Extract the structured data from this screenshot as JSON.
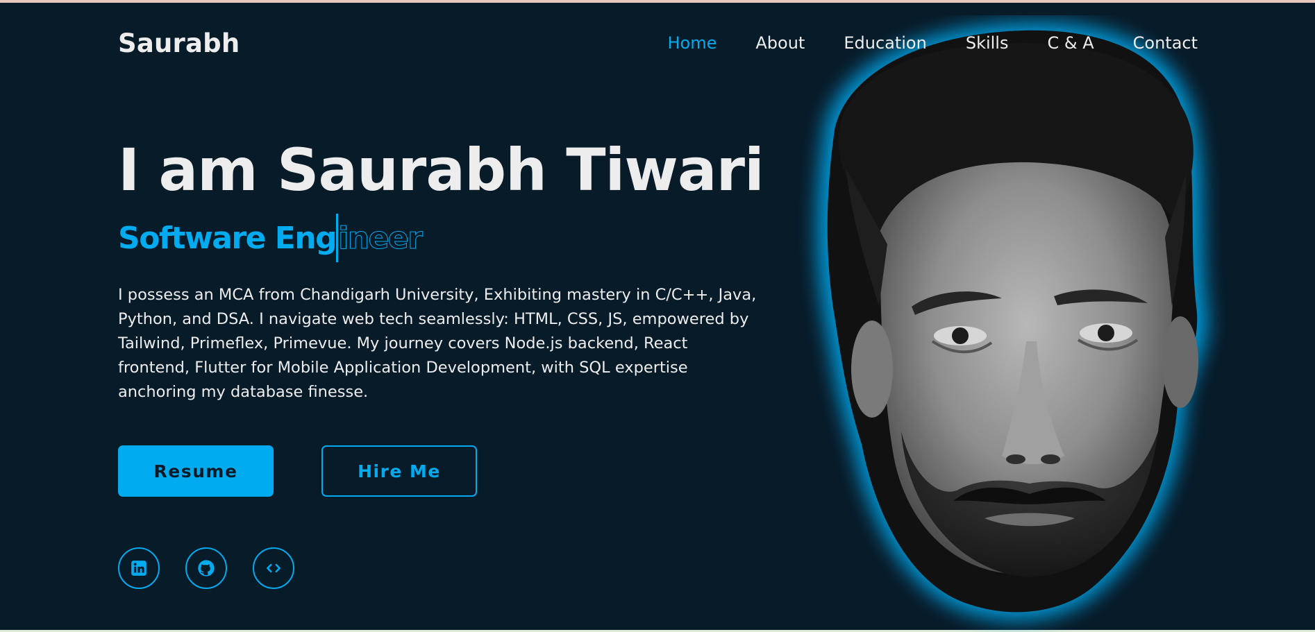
{
  "brand": {
    "name": "Saurabh"
  },
  "nav": {
    "items": [
      {
        "label": "Home",
        "active": true
      },
      {
        "label": "About",
        "active": false
      },
      {
        "label": "Education",
        "active": false
      },
      {
        "label": "Skills",
        "active": false
      },
      {
        "label": "C & A",
        "active": false
      },
      {
        "label": "Contact",
        "active": false
      }
    ]
  },
  "hero": {
    "title": "I am Saurabh Tiwari",
    "subtitle_filled": "Software Eng",
    "subtitle_outline": "ineer",
    "bio": "I possess an MCA from Chandigarh University, Exhibiting mastery in C/C++, Java, Python, and DSA. I navigate web tech seamlessly: HTML, CSS, JS, empowered by Tailwind, Primeflex, Primevue. My journey covers Node.js backend, React frontend, Flutter for Mobile Application Development, with SQL expertise anchoring my database finesse."
  },
  "buttons": {
    "resume": "Resume",
    "hire": "Hire Me"
  },
  "socials": [
    {
      "icon": "linkedin-icon"
    },
    {
      "icon": "github-icon"
    },
    {
      "icon": "code-icon"
    }
  ],
  "colors": {
    "background": "#081b29",
    "accent": "#00abf0",
    "text": "#ededed"
  }
}
